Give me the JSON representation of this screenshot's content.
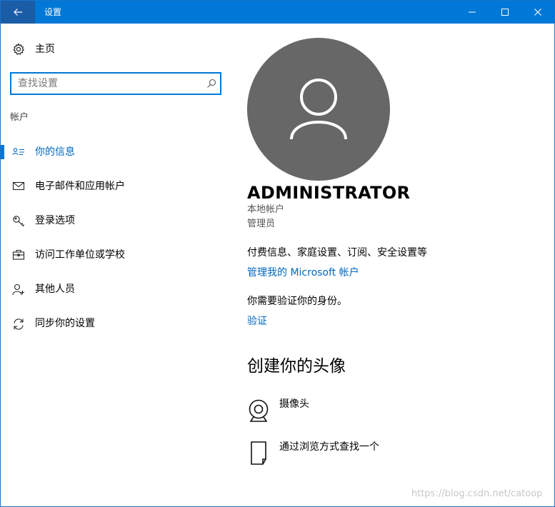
{
  "window": {
    "title": "设置",
    "controls": {
      "back": "back-arrow-icon",
      "minimize": "minimize-icon",
      "maximize": "maximize-icon",
      "close": "close-icon"
    },
    "accent_color": "#0078d7"
  },
  "sidebar": {
    "home_label": "主页",
    "search": {
      "placeholder": "查找设置",
      "value": ""
    },
    "section_header": "帐户",
    "items": [
      {
        "label": "你的信息",
        "icon": "user-card-icon",
        "selected": true
      },
      {
        "label": "电子邮件和应用帐户",
        "icon": "mail-icon",
        "selected": false
      },
      {
        "label": "登录选项",
        "icon": "key-icon",
        "selected": false
      },
      {
        "label": "访问工作单位或学校",
        "icon": "briefcase-icon",
        "selected": false
      },
      {
        "label": "其他人员",
        "icon": "person-add-icon",
        "selected": false
      },
      {
        "label": "同步你的设置",
        "icon": "sync-icon",
        "selected": false
      }
    ]
  },
  "main": {
    "user_name": "ADMINISTRATOR",
    "account_type": "本地帐户",
    "role": "管理员",
    "billing_text": "付费信息、家庭设置、订阅、安全设置等",
    "manage_link": "管理我的 Microsoft 帐户",
    "verify_text": "你需要验证你的身份。",
    "verify_link": "验证",
    "create_avatar_title": "创建你的头像",
    "avatar_options": [
      {
        "label": "摄像头",
        "icon": "webcam-icon"
      },
      {
        "label": "通过浏览方式查找一个",
        "icon": "browse-file-icon"
      }
    ]
  },
  "watermark": "https://blog.csdn.net/catoop"
}
